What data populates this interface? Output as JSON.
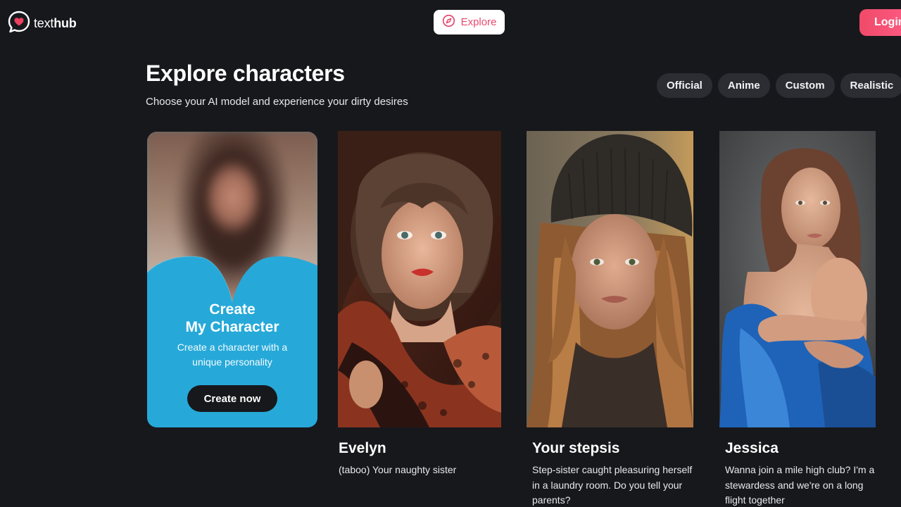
{
  "header": {
    "logo_text_light": "text",
    "logo_text_bold": "hub",
    "logo_icon": "heart-chat-icon",
    "explore_label": "Explore",
    "explore_icon": "compass-icon",
    "login_label": "Login"
  },
  "page": {
    "title": "Explore characters",
    "subtitle": "Choose your AI model and experience your dirty desires"
  },
  "filters": [
    "Official",
    "Anime",
    "Custom",
    "Realistic"
  ],
  "create_card": {
    "title_line1": "Create",
    "title_line2": "My Character",
    "description": "Create a character with a unique personality",
    "button_label": "Create now"
  },
  "characters": [
    {
      "name": "Evelyn",
      "description": "(taboo) Your naughty sister"
    },
    {
      "name": "Your stepsis",
      "description": "Step-sister caught pleasuring herself in a laundry room. Do you tell your parents?"
    },
    {
      "name": "Jessica",
      "description": "Wanna join a mile high club? I'm a stewardess and we're on a long flight together"
    }
  ],
  "colors": {
    "background": "#17181c",
    "accent_pink": "#f04a68",
    "create_blue": "#26a9d8",
    "chip_bg": "#2c2d33"
  }
}
